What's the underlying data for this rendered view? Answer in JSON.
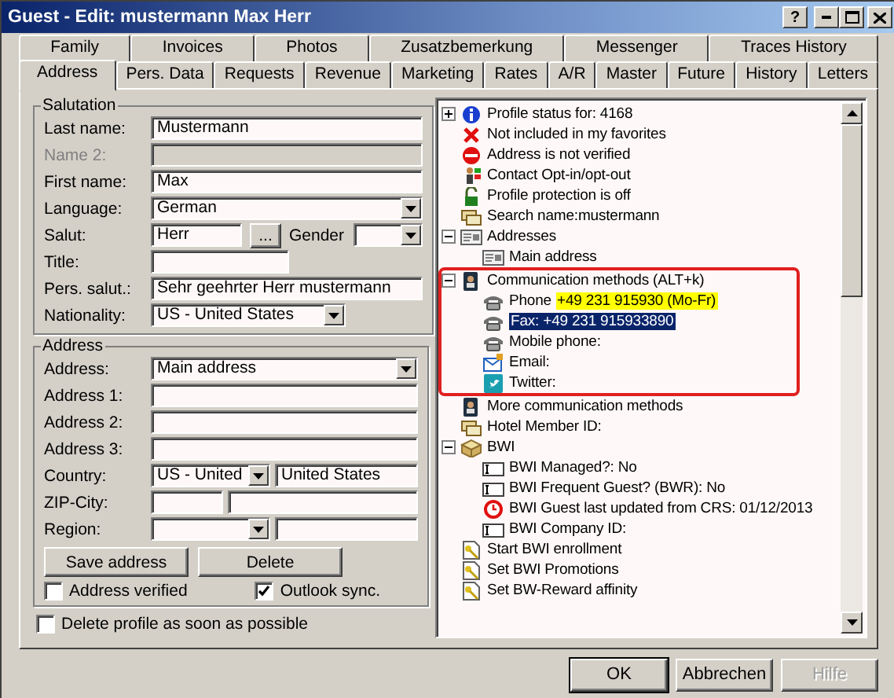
{
  "window": {
    "title": "Guest - Edit: mustermann Max Herr",
    "help": "?"
  },
  "back_tabs": [
    {
      "label": "Family",
      "selected": false
    },
    {
      "label": "Invoices",
      "selected": false
    },
    {
      "label": "Photos",
      "selected": false
    },
    {
      "label": "Zusatzbemerkung",
      "selected": false
    },
    {
      "label": "Messenger",
      "selected": false
    },
    {
      "label": "Traces History",
      "selected": false
    }
  ],
  "front_tabs": [
    {
      "label": "Address",
      "selected": true
    },
    {
      "label": "Pers. Data",
      "selected": false
    },
    {
      "label": "Requests",
      "selected": false
    },
    {
      "label": "Revenue",
      "selected": false
    },
    {
      "label": "Marketing",
      "selected": false
    },
    {
      "label": "Rates",
      "selected": false
    },
    {
      "label": "A/R",
      "selected": false
    },
    {
      "label": "Master",
      "selected": false
    },
    {
      "label": "Future",
      "selected": false
    },
    {
      "label": "History",
      "selected": false
    },
    {
      "label": "Letters",
      "selected": false
    }
  ],
  "salutation": {
    "title": "Salutation",
    "rows": [
      {
        "kind": "text",
        "label": "Last name:",
        "value": "Mustermann",
        "disabled": false
      },
      {
        "kind": "text",
        "label": "Name 2:",
        "disabled": true
      },
      {
        "kind": "text",
        "label": "First name:",
        "value": "Max",
        "disabled": false
      },
      {
        "kind": "combo",
        "label": "Language:",
        "value": "German",
        "disabled": false
      },
      {
        "kind": "salut",
        "label": "Salut:",
        "value": "Herr",
        "button": "...",
        "label2": "Gender",
        "disabled": false
      },
      {
        "kind": "short-text",
        "label": "Title:",
        "disabled": false
      },
      {
        "kind": "text",
        "label": "Pers. salut.:",
        "value": "Sehr geehrter Herr mustermann",
        "disabled": false
      },
      {
        "kind": "short-combo",
        "label": "Nationality:",
        "value": "US - United States",
        "disabled": false
      }
    ]
  },
  "address": {
    "title": "Address",
    "rows": [
      {
        "kind": "combo",
        "label": "Address:",
        "value": "Main address",
        "disabled": false
      },
      {
        "kind": "text",
        "label": "Address 1:",
        "disabled": false
      },
      {
        "kind": "text",
        "label": "Address 2:",
        "disabled": false
      },
      {
        "kind": "text",
        "label": "Address 3:",
        "disabled": false
      },
      {
        "kind": "combo-text",
        "label": "Country:",
        "values": [
          "US - United",
          "United States"
        ],
        "disabled": false
      },
      {
        "kind": "text-text",
        "label": "ZIP-City:",
        "values": [],
        "disabled": false
      },
      {
        "kind": "combo-text",
        "label": "Region:",
        "values": [],
        "disabled": false
      }
    ],
    "buttons": [
      "Save address",
      "Delete"
    ],
    "checkboxes": [
      {
        "label": "Address verified",
        "checked": false
      },
      {
        "label": "Outlook sync.",
        "checked": true
      }
    ]
  },
  "delete_profile": {
    "label": "Delete profile as soon as possible",
    "checked": false
  },
  "tree": [
    {
      "kind": "info",
      "text": "Profile status for: 4168",
      "expanded": false,
      "selected": false
    },
    {
      "kind": "cross",
      "text": "Not included in my favorites",
      "selected": false
    },
    {
      "kind": "no-entry",
      "text": "Address is not verified",
      "selected": false
    },
    {
      "kind": "person",
      "text": "Contact Opt-in/opt-out",
      "selected": false
    },
    {
      "kind": "padlock",
      "text": "Profile protection is off",
      "selected": false
    },
    {
      "kind": "cards",
      "text": "Search name:mustermann",
      "selected": false
    },
    {
      "kind": "address-card",
      "text": "Addresses",
      "expanded": true,
      "selected": false,
      "children": [
        {
          "kind": "address-card",
          "text": "Main address",
          "selected": false
        }
      ]
    },
    {
      "kind": "contacts",
      "text": "Communication methods (ALT+k)",
      "expanded": true,
      "outlined": true,
      "selected": false,
      "children": [
        {
          "kind": "telephone",
          "text": "Phone",
          "value": "+49 231 915930 (Mo-Fr)",
          "highlight": true,
          "selected": false
        },
        {
          "kind": "telephone",
          "text": "Fax: +49 231 915933890",
          "selected": true
        },
        {
          "kind": "telephone",
          "text": "Mobile phone:",
          "selected": false
        },
        {
          "kind": "email",
          "text": "Email:",
          "selected": false
        },
        {
          "kind": "bird",
          "text": "Twitter:",
          "selected": false
        }
      ]
    },
    {
      "kind": "contacts",
      "text": "More communication methods",
      "selected": false
    },
    {
      "kind": "cards",
      "text": "Hotel Member ID:",
      "selected": false
    },
    {
      "kind": "box",
      "text": "BWI",
      "expanded": true,
      "selected": false,
      "children": [
        {
          "kind": "field",
          "text": "BWI Managed?: No",
          "selected": false
        },
        {
          "kind": "field",
          "text": "BWI Frequent Guest? (BWR): No",
          "selected": false
        },
        {
          "kind": "clock",
          "text": "BWI Guest last updated from CRS: 01/12/2013",
          "selected": false
        },
        {
          "kind": "field",
          "text": "BWI Company ID:",
          "selected": false
        }
      ]
    },
    {
      "kind": "key-document",
      "text": "Start BWI enrollment",
      "selected": false
    },
    {
      "kind": "key-document",
      "text": "Set BWI Promotions",
      "selected": false
    },
    {
      "kind": "key-document",
      "text": "Set BW-Reward affinity",
      "selected": false
    }
  ],
  "buttons": [
    {
      "label": "OK",
      "disabled": false,
      "default": true
    },
    {
      "label": "Abbrechen",
      "disabled": false,
      "default": false
    },
    {
      "label": "Hilfe",
      "disabled": true,
      "default": false
    }
  ]
}
